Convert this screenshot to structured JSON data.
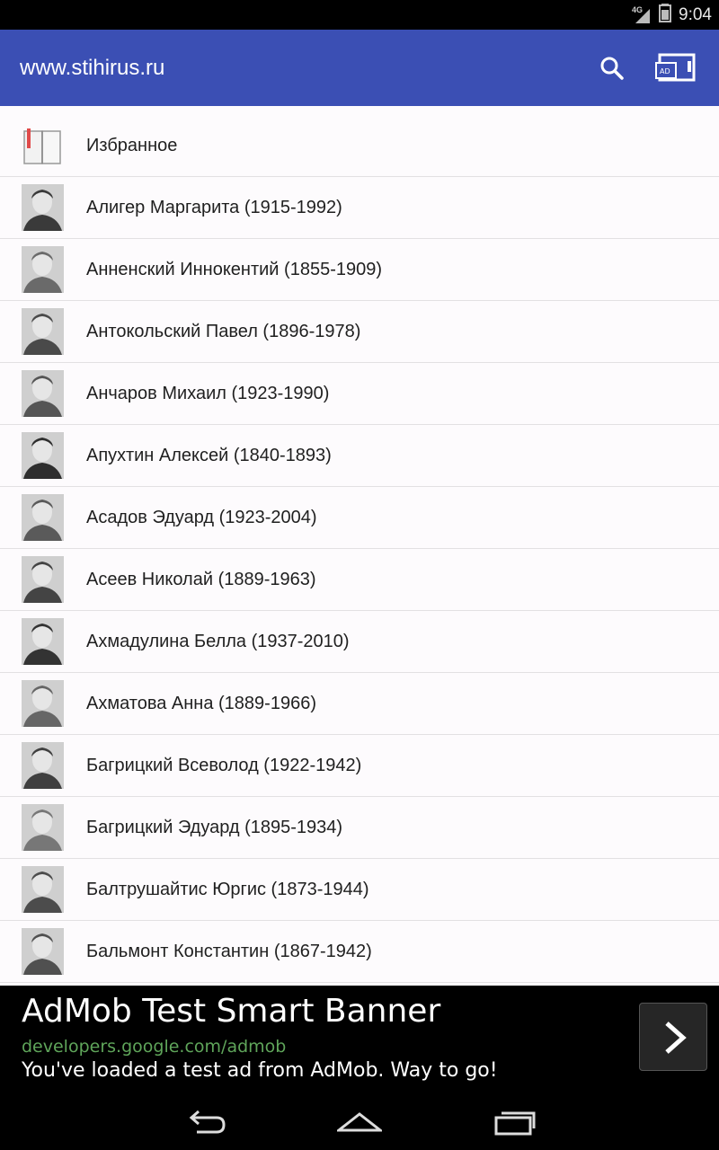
{
  "status_bar": {
    "network_label": "4G",
    "time": "9:04",
    "icons": [
      "signal-icon",
      "battery-icon"
    ]
  },
  "app_bar": {
    "title": "www.stihirus.ru",
    "color": "#3b4fb4",
    "actions": [
      "search-icon",
      "ad-cast-icon"
    ]
  },
  "list": {
    "favorites_label": "Избранное",
    "authors": [
      "Алигер Маргарита (1915-1992)",
      "Анненский Иннокентий (1855-1909)",
      "Антокольский Павел (1896-1978)",
      "Анчаров Михаил (1923-1990)",
      "Апухтин Алексей (1840-1893)",
      "Асадов Эдуард (1923-2004)",
      "Асеев Николай (1889-1963)",
      "Ахмадулина Белла (1937-2010)",
      "Ахматова Анна (1889-1966)",
      "Багрицкий Всеволод (1922-1942)",
      "Багрицкий Эдуард (1895-1934)",
      "Балтрушайтис Юргис (1873-1944)",
      "Бальмонт Константин (1867-1942)"
    ]
  },
  "ad": {
    "title": "AdMob Test Smart Banner",
    "url": "developers.google.com/admob",
    "text": "You've loaded a test ad from AdMob. Way to go!",
    "url_color": "#5fa55a"
  },
  "nav_bar": {
    "buttons": [
      "back-icon",
      "home-icon",
      "recents-icon"
    ]
  }
}
